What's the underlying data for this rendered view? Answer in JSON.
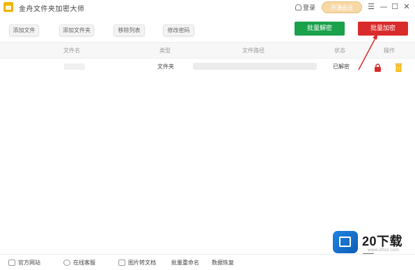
{
  "titlebar": {
    "app_title": "金舟文件夹加密大师",
    "login_label": "登录",
    "vip_label": "开通会员",
    "menu_icon": "menu-icon",
    "minimize_icon": "minimize-icon",
    "maximize_icon": "maximize-icon",
    "close_icon": "close-icon"
  },
  "toolbar": {
    "buttons": [
      "添加文件",
      "添加文件夹",
      "移除列表",
      "修改密码"
    ],
    "batch_decrypt": "批量解密",
    "batch_encrypt": "批量加密"
  },
  "table": {
    "headers": [
      "文件名",
      "类型",
      "文件路径",
      "状态",
      "操作"
    ],
    "rows": [
      {
        "type": "文件夹",
        "status": "已解密"
      }
    ]
  },
  "footer": {
    "items": [
      "官方网站",
      "在线客服",
      "图片转文档",
      "批量重命名",
      "数据恢复"
    ]
  },
  "watermark": {
    "brand": "20下载网",
    "url": "www.20xz.com"
  },
  "colors": {
    "decrypt_green": "#1aa14a",
    "encrypt_red": "#d92b2b",
    "vip_gold": "#f6d9a6",
    "app_yellow": "#f2b400"
  }
}
